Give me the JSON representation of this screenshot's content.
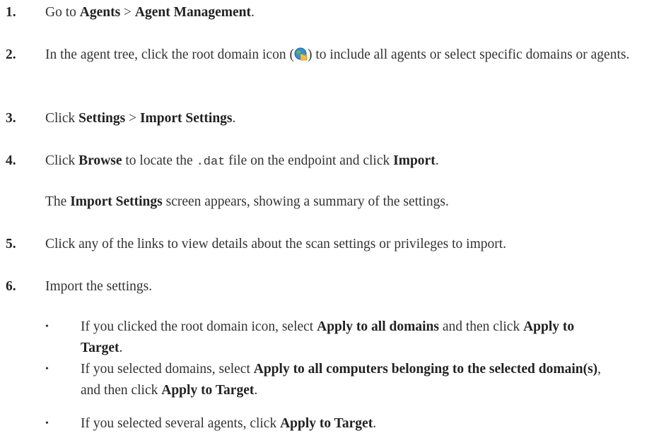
{
  "steps": [
    {
      "num": "1.",
      "parts": [
        "Go to ",
        "Agents",
        " > ",
        "Agent Management",
        "."
      ]
    },
    {
      "num": "2.",
      "parts": [
        "In the agent tree, click the root domain icon (",
        ") to include all agents or select specific domains or agents."
      ]
    },
    {
      "num": "3.",
      "parts": [
        "Click ",
        "Settings",
        " > ",
        "Import Settings",
        "."
      ]
    },
    {
      "num": "4.",
      "parts": [
        "Click ",
        "Browse",
        " to locate the ",
        ".dat",
        " file on the endpoint and click ",
        "Import",
        "."
      ]
    },
    {
      "num": "5.",
      "parts": [
        "Click any of the links to view details about the scan settings or privileges to import."
      ]
    },
    {
      "num": "6.",
      "parts": [
        "Import the settings."
      ]
    }
  ],
  "note": [
    "The ",
    "Import Settings",
    " screen appears, showing a summary of the settings."
  ],
  "bullets": [
    {
      "mark": "•",
      "parts": [
        "If you clicked the root domain icon, select ",
        "Apply to all domains",
        " and then click ",
        "Apply to Target",
        "."
      ]
    },
    {
      "mark": "•",
      "parts": [
        "If you selected domains, select ",
        "Apply to all computers belonging to the selected domain(s)",
        ", and then click ",
        "Apply to Target",
        "."
      ]
    },
    {
      "mark": "•",
      "parts": [
        "If you selected several agents, click ",
        "Apply to Target",
        "."
      ]
    }
  ],
  "icons": {
    "root_domain": "globe-folder-icon"
  }
}
